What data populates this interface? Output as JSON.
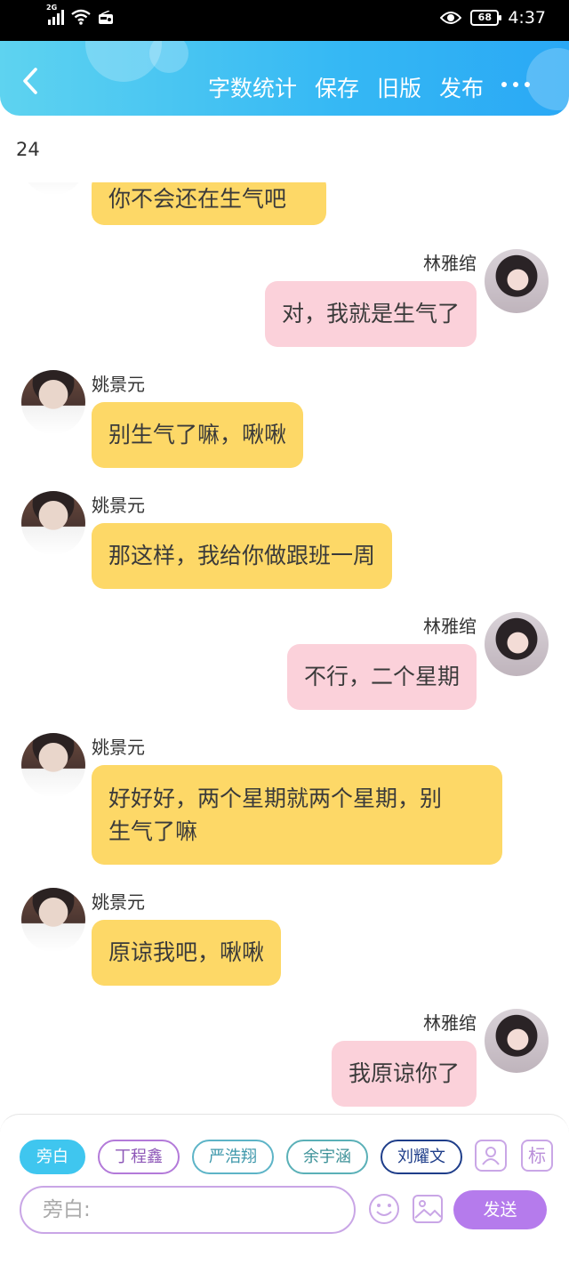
{
  "status_bar": {
    "network": "2G",
    "battery": "68",
    "time": "4:37"
  },
  "header": {
    "actions": [
      "字数统计",
      "保存",
      "旧版",
      "发布"
    ],
    "accent_gradient": [
      "#5ed3f0",
      "#2aa8f5"
    ]
  },
  "word_count": "24",
  "messages": [
    {
      "side": "left",
      "sender": "",
      "text": "你不会还在生气吧",
      "color": "#fdd867"
    },
    {
      "side": "right",
      "sender": "林雅绾",
      "text": "对，我就是生气了",
      "color": "#fbd1da"
    },
    {
      "side": "left",
      "sender": "姚景元",
      "text": "别生气了嘛，啾啾",
      "color": "#fdd867"
    },
    {
      "side": "left",
      "sender": "姚景元",
      "text": "那这样，我给你做跟班一周",
      "color": "#fdd867"
    },
    {
      "side": "right",
      "sender": "林雅绾",
      "text": "不行，二个星期",
      "color": "#fbd1da"
    },
    {
      "side": "left",
      "sender": "姚景元",
      "text_line1": "好好好，两个星期就两个星期，别",
      "text_line2": "生气了嘛",
      "color": "#fdd867"
    },
    {
      "side": "left",
      "sender": "姚景元",
      "text": "原谅我吧，啾啾",
      "color": "#fdd867"
    },
    {
      "side": "right",
      "sender": "林雅绾",
      "text": "我原谅你了",
      "color": "#fbd1da"
    }
  ],
  "composer": {
    "roles": [
      "旁白",
      "丁程鑫",
      "严浩翔",
      "余宇涵",
      "刘耀文"
    ],
    "active_role": "旁白",
    "role_tag_icon_text": "标",
    "input_placeholder": "旁白:",
    "send_label": "发送",
    "icons": [
      "role-manage-icon",
      "tag-icon",
      "emoji-icon",
      "image-icon"
    ],
    "send_color": "#b57bec"
  }
}
